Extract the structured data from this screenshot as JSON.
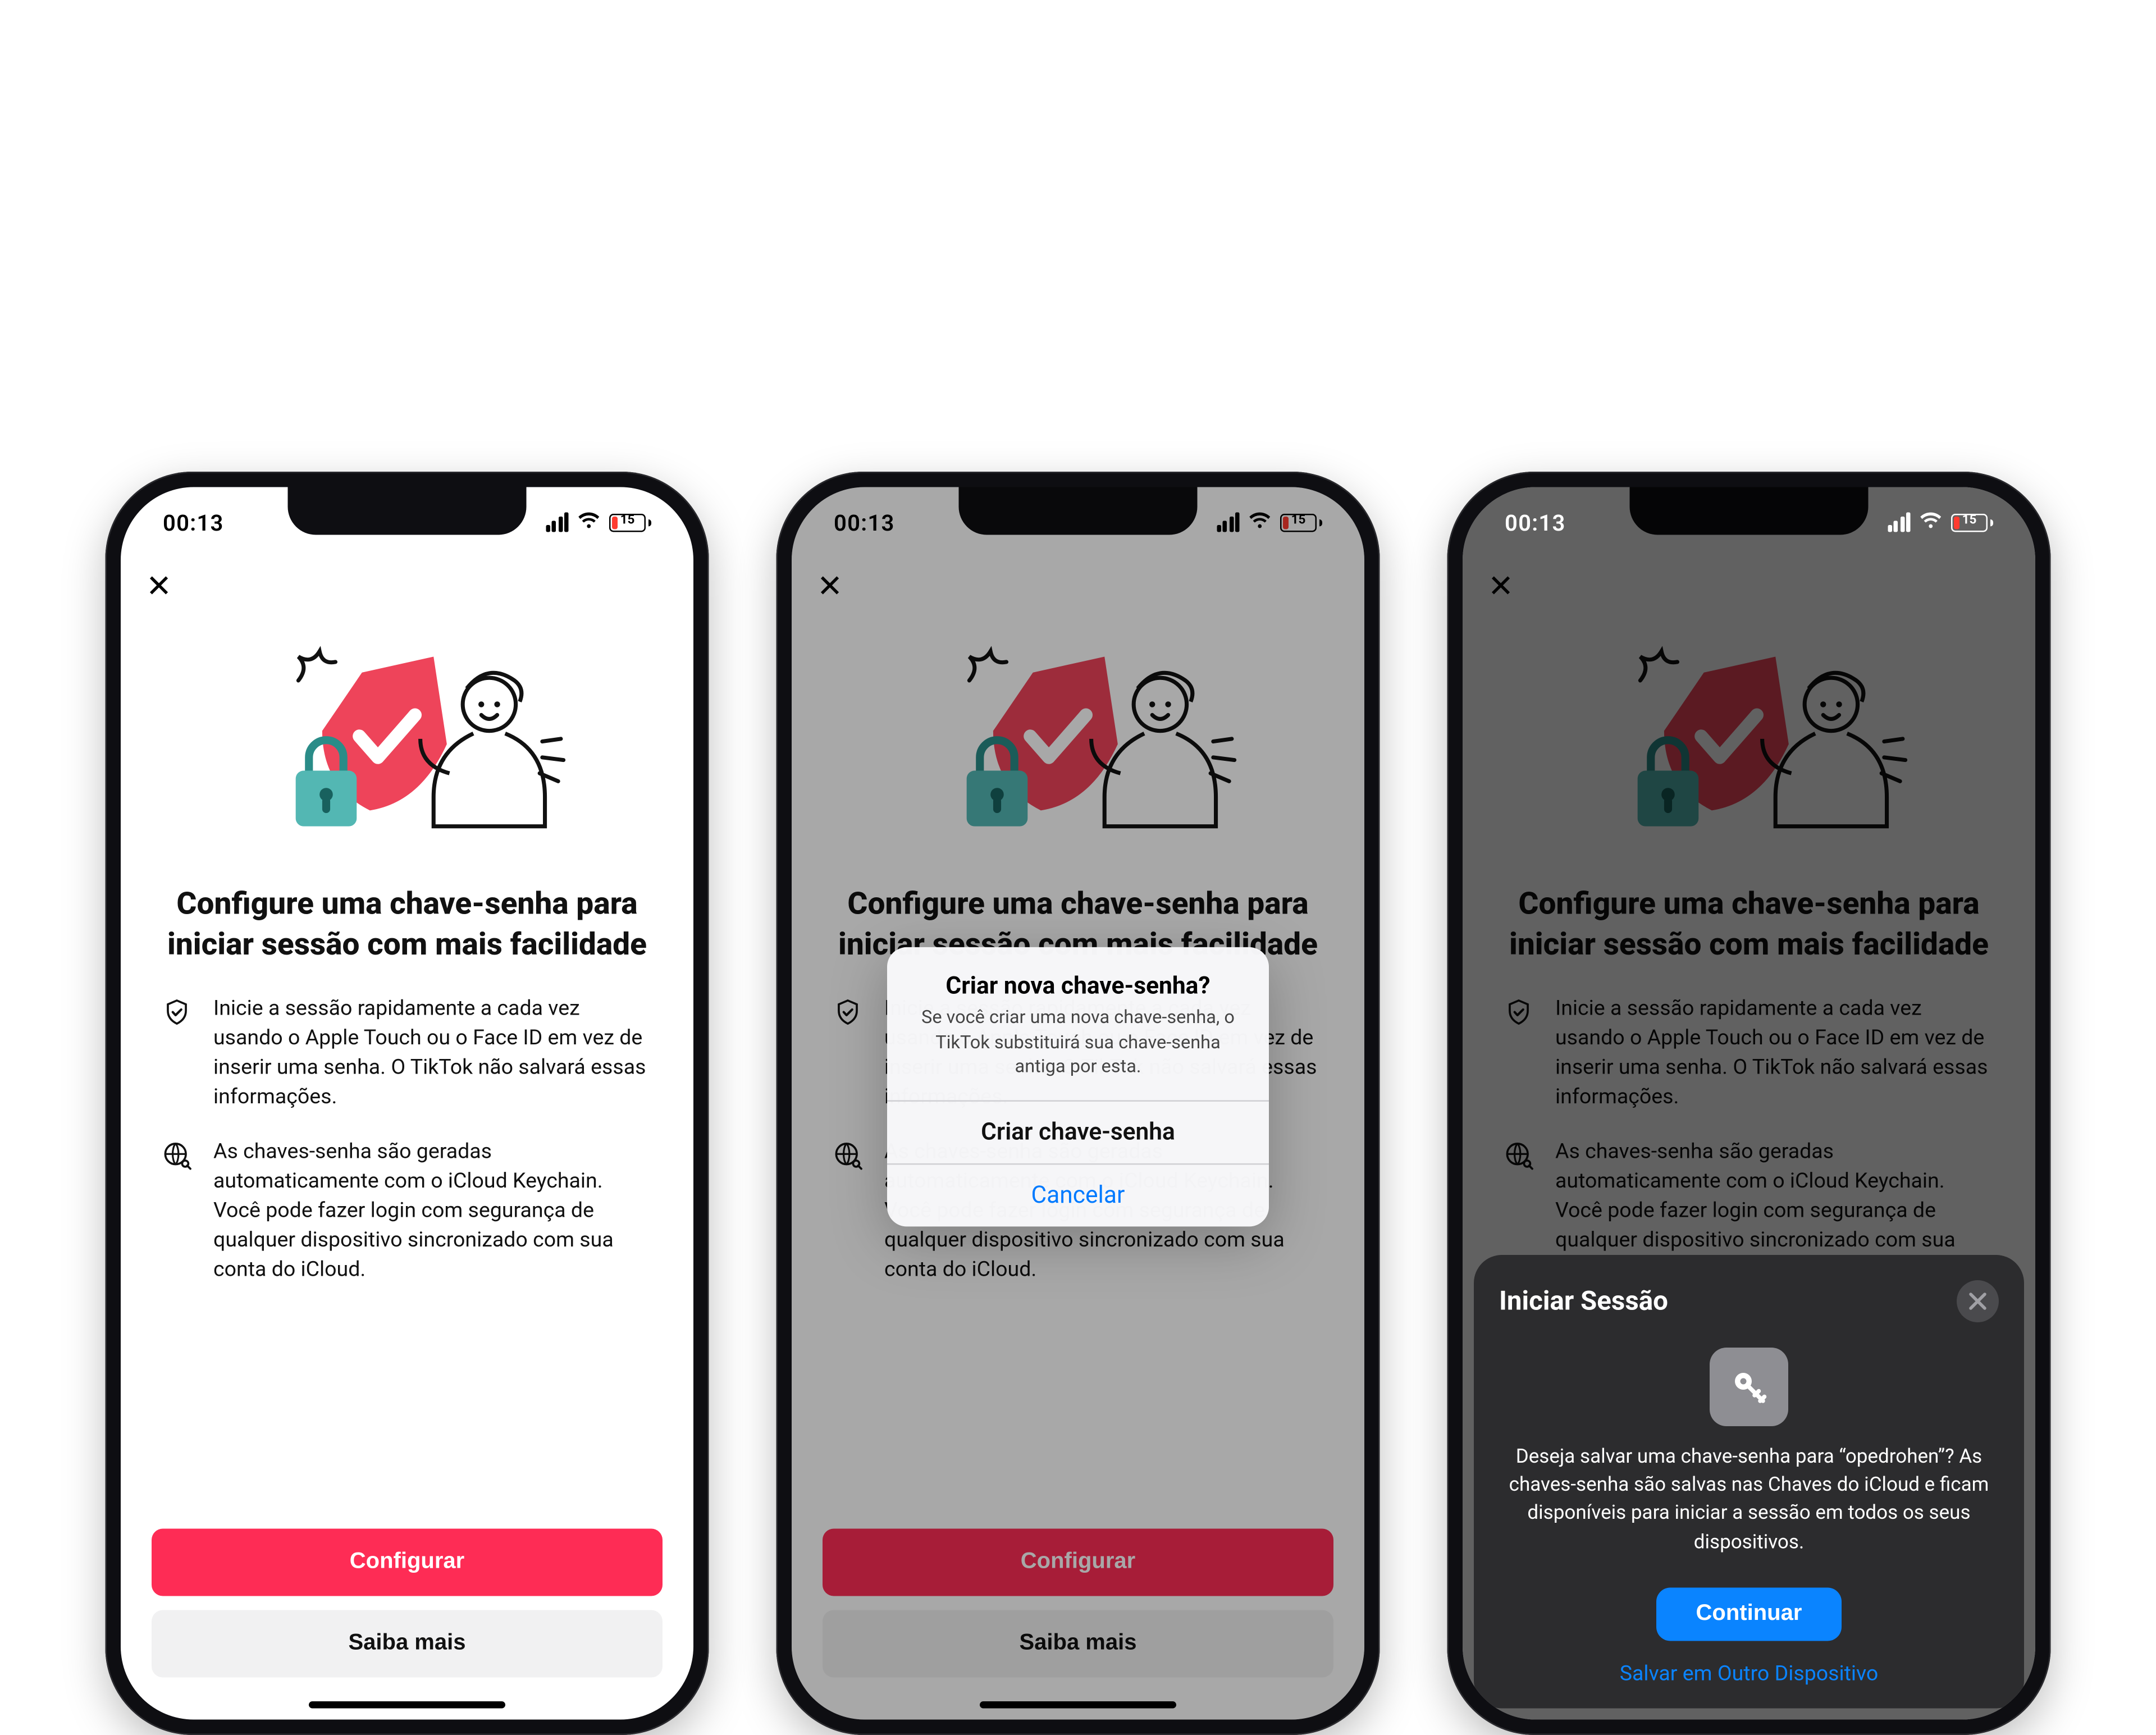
{
  "status": {
    "time": "00:13",
    "battery_pct": "15"
  },
  "hero_colors": {
    "shield": "#ee445a",
    "lock": "#53b7b3"
  },
  "passkey": {
    "title": "Configure uma chave-senha para iniciar sessão com mais facilidade",
    "bullet1": "Inicie a sessão rapidamente a cada vez usando o Apple Touch ou o Face ID em vez de inserir uma senha. O TikTok não salvará essas informações.",
    "bullet2": "As chaves-senha são geradas automaticamente com o iCloud Keychain. Você pode fazer login com segurança de qualquer dispositivo sincronizado com sua conta do iCloud.",
    "btn_primary": "Configurar",
    "btn_secondary": "Saiba mais"
  },
  "alert": {
    "title": "Criar nova chave-senha?",
    "message": "Se você criar uma nova chave-senha, o TikTok substituirá sua chave-senha antiga por esta.",
    "confirm": "Criar chave-senha",
    "cancel": "Cancelar"
  },
  "sheet": {
    "title": "Iniciar Sessão",
    "message": "Deseja salvar uma chave-senha para “opedrohen”? As chaves-senha são salvas nas Chaves do iCloud e ficam disponíveis para iniciar a sessão em todos os seus dispositivos.",
    "continue": "Continuar",
    "other_device": "Salvar em Outro Dispositivo"
  }
}
